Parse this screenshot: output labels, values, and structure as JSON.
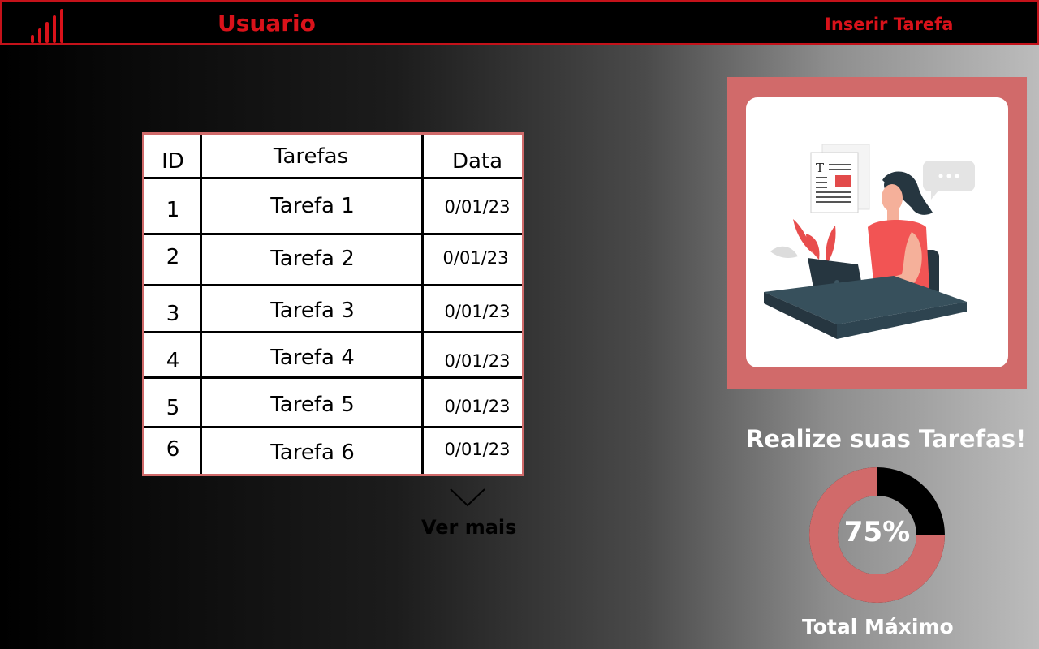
{
  "header": {
    "logo": "signal-bars-icon",
    "user_label": "Usuario",
    "insert_label": "Inserir Tarefa"
  },
  "table": {
    "headers": {
      "id": "ID",
      "task": "Tarefas",
      "date": "Data"
    },
    "rows": [
      {
        "id": "1",
        "task": "Tarefa 1",
        "date": "0/01/23"
      },
      {
        "id": "2",
        "task": "Tarefa 2",
        "date": "0/01/23"
      },
      {
        "id": "3",
        "task": "Tarefa 3",
        "date": "0/01/23"
      },
      {
        "id": "4",
        "task": "Tarefa 4",
        "date": "0/01/23"
      },
      {
        "id": "5",
        "task": "Tarefa 5",
        "date": "0/01/23"
      },
      {
        "id": "6",
        "task": "Tarefa 6",
        "date": "0/01/23"
      }
    ]
  },
  "see_more": {
    "icon": "chevron-down-icon",
    "label": "Ver mais"
  },
  "illustration": {
    "icon": "woman-at-laptop-illustration"
  },
  "progress": {
    "title": "Realize suas Tarefas!",
    "value_label": "75%",
    "fraction": 0.75,
    "caption": "Total Máximo"
  },
  "colors": {
    "accent_red": "#d9121a",
    "rose": "#d16a6a",
    "dark_slate": "#2e4450"
  }
}
